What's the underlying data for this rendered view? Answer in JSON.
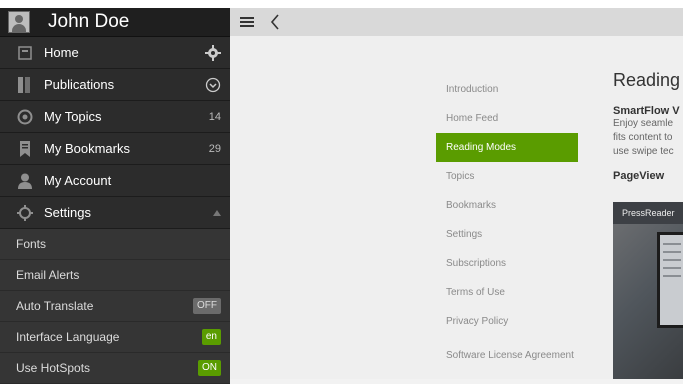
{
  "user": {
    "name": "John Doe"
  },
  "sidebar": {
    "items": [
      {
        "label": "Home",
        "icon": "home-icon"
      },
      {
        "label": "Publications",
        "icon": "publications-icon"
      },
      {
        "label": "My Topics",
        "count": "14",
        "icon": "topics-icon"
      },
      {
        "label": "My Bookmarks",
        "count": "29",
        "icon": "bookmark-icon"
      },
      {
        "label": "My Account",
        "icon": "account-icon"
      },
      {
        "label": "Settings",
        "icon": "gear-icon"
      }
    ],
    "settings": [
      {
        "label": "Fonts"
      },
      {
        "label": "Email Alerts"
      },
      {
        "label": "Auto Translate",
        "badge": "OFF"
      },
      {
        "label": "Interface Language",
        "badge": "en"
      },
      {
        "label": "Use HotSpots",
        "badge": "ON"
      }
    ]
  },
  "helpnav": {
    "items": [
      "Introduction",
      "Home Feed",
      "Reading Modes",
      "Topics",
      "Bookmarks",
      "Settings",
      "Subscriptions",
      "Terms of Use",
      "Privacy Policy",
      "Software License Agreement"
    ],
    "active": "Reading Modes"
  },
  "content": {
    "title": "Reading",
    "section1": "SmartFlow V",
    "lines": [
      "Enjoy seamle",
      "fits content to",
      "use swipe tec"
    ],
    "section2": "PageView",
    "pageview_label": "PressReader"
  },
  "colors": {
    "accent": "#5a9c00",
    "sidebar": "#2c2c2c"
  }
}
